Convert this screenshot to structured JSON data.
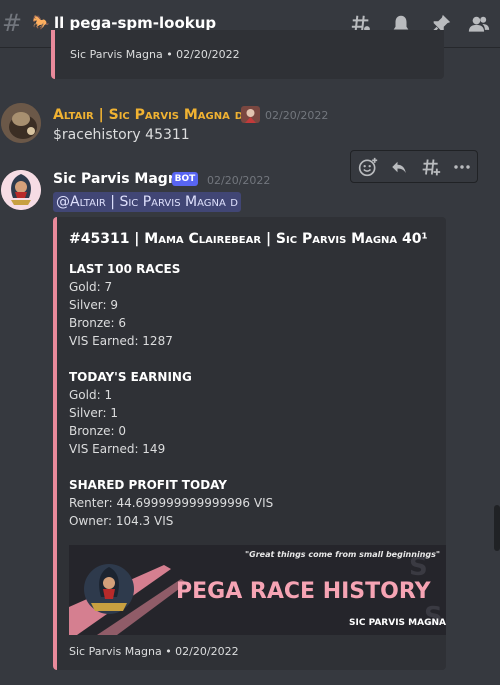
{
  "channel": {
    "emoji": "🐎",
    "name": "ll pega-spm-lookup",
    "icons": [
      "threads-icon",
      "bell-icon",
      "pin-icon",
      "members-icon"
    ]
  },
  "previous_embed": {
    "footer": "Sic Parvis Magna • 02/20/2022"
  },
  "message_user": {
    "username": "Altair | Sic Parvis Magna d",
    "name_color": "#f0b232",
    "timestamp": "02/20/2022",
    "content": "$racehistory 45311"
  },
  "message_bot": {
    "username": "Sic Parvis Magna",
    "bot_tag": "BOT",
    "timestamp": "02/20/2022",
    "mention": "@Altair | Sic Parvis Magna d",
    "embed": {
      "accent_color": "#e98a9b",
      "title": "#45311 | Mama Clairebear | Sic Parvis Magna 40¹",
      "last100": {
        "heading": "LAST 100 RACES",
        "gold": "Gold: 7",
        "silver": "Silver: 9",
        "bronze": "Bronze: 6",
        "vis": "VIS Earned: 1287"
      },
      "today": {
        "heading": "TODAY'S EARNING",
        "gold": "Gold: 1",
        "silver": "Silver: 1",
        "bronze": "Bronze: 0",
        "vis": "VIS Earned: 149"
      },
      "shared": {
        "heading": "SHARED PROFIT TODAY",
        "renter": "Renter: 44.699999999999996 VIS",
        "owner": "Owner: 104.3 VIS"
      },
      "banner": {
        "quote": "\"Great things come from small beginnings\"",
        "title": "PEGA RACE HISTORY",
        "subtitle": "SIC PARVIS MAGNA"
      },
      "footer": "Sic Parvis Magna • 02/20/2022"
    }
  },
  "toolbar": {
    "buttons": [
      "add-reaction-icon",
      "reply-icon",
      "create-thread-icon",
      "more-icon"
    ]
  }
}
